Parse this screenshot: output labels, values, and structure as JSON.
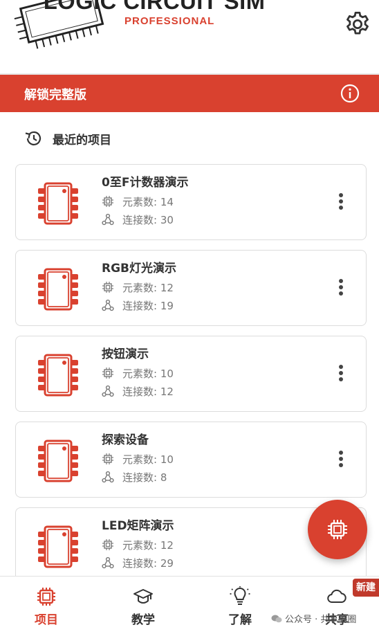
{
  "app": {
    "logo_title": "LOGIC CIRCUIT SIM",
    "logo_subtitle": "PROFESSIONAL",
    "settings_icon": "gear-icon"
  },
  "colors": {
    "accent": "#d9412f",
    "text": "#333333",
    "muted": "#777777"
  },
  "unlock_bar": {
    "label": "解锁完整版",
    "icon": "info-icon"
  },
  "recent": {
    "title": "最近的项目",
    "icon": "history-icon"
  },
  "projects": [
    {
      "name": "0至F计数器演示",
      "elements": "元素数: 14",
      "connections": "连接数: 30"
    },
    {
      "name": "RGB灯光演示",
      "elements": "元素数: 12",
      "connections": "连接数: 19"
    },
    {
      "name": "按钮演示",
      "elements": "元素数: 10",
      "connections": "连接数: 12"
    },
    {
      "name": "探索设备",
      "elements": "元素数: 10",
      "connections": "连接数: 8"
    },
    {
      "name": "LED矩阵演示",
      "elements": "元素数: 12",
      "connections": "连接数: 29"
    }
  ],
  "fab": {
    "icon": "chip-icon"
  },
  "bottom_nav": [
    {
      "label": "项目",
      "icon": "chip-icon",
      "active": true
    },
    {
      "label": "教学",
      "icon": "graduation-cap-icon",
      "active": false
    },
    {
      "label": "了解",
      "icon": "lightbulb-icon",
      "active": false
    },
    {
      "label": "共享",
      "icon": "cloud-icon",
      "active": false
    }
  ],
  "badge": {
    "label": "新建"
  },
  "watermark": {
    "text": "公众号 · 共享到圈"
  }
}
